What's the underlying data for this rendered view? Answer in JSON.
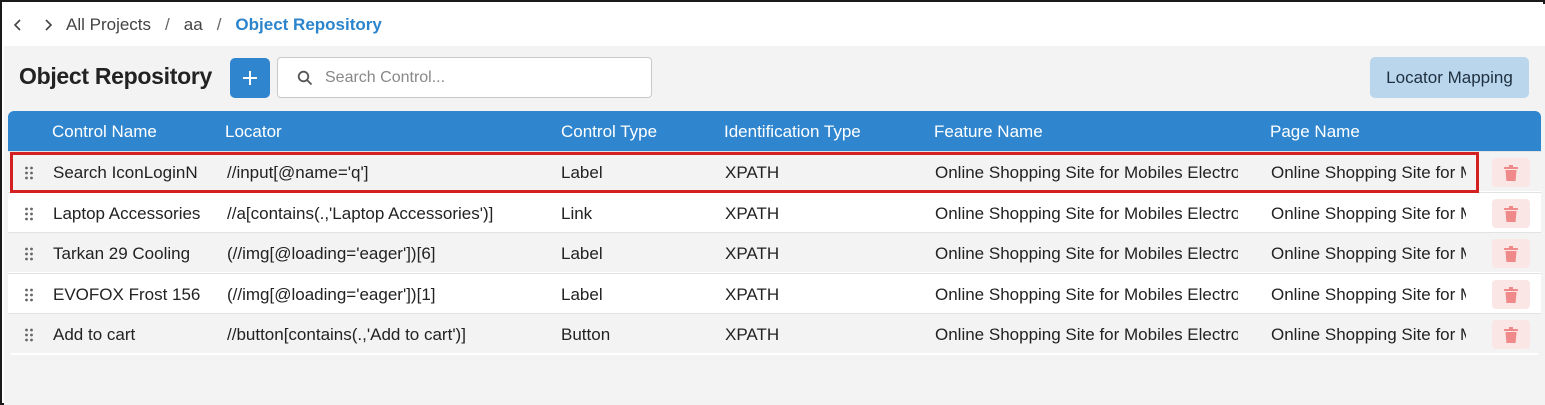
{
  "breadcrumb": {
    "items": [
      "All Projects",
      "aa"
    ],
    "separator": "/",
    "current": "Object Repository"
  },
  "header": {
    "title": "Object Repository",
    "search_placeholder": "Search Control...",
    "locator_mapping_label": "Locator Mapping"
  },
  "table": {
    "columns": [
      "Control Name",
      "Locator",
      "Control Type",
      "Identification Type",
      "Feature Name",
      "Page Name"
    ],
    "rows": [
      [
        "Search IconLoginN",
        "//input[@name='q']",
        "Label",
        "XPATH",
        "Online Shopping Site for Mobiles Electro",
        "Online Shopping Site for M"
      ],
      [
        "Laptop Accessories",
        "//a[contains(.,'Laptop Accessories')]",
        "Link",
        "XPATH",
        "Online Shopping Site for Mobiles Electro",
        "Online Shopping Site for M"
      ],
      [
        "Tarkan 29 Cooling",
        "(//img[@loading='eager'])[6]",
        "Label",
        "XPATH",
        "Online Shopping Site for Mobiles Electro",
        "Online Shopping Site for M"
      ],
      [
        "EVOFOX Frost 156",
        "(//img[@loading='eager'])[1]",
        "Label",
        "XPATH",
        "Online Shopping Site for Mobiles Electro",
        "Online Shopping Site for M"
      ],
      [
        "Add to cart",
        "//button[contains(.,'Add to cart')]",
        "Button",
        "XPATH",
        "Online Shopping Site for Mobiles Electro",
        "Online Shopping Site for M"
      ]
    ]
  },
  "icons": {
    "back": "chevron-left-icon",
    "forward": "chevron-right-icon",
    "add": "plus-icon",
    "search": "search-icon",
    "drag": "drag-handle-icon",
    "delete": "trash-icon"
  },
  "colors": {
    "accent": "#2f86cf",
    "breadcrumb_active": "#2b84cc",
    "locator_button": "#b9d6ec",
    "delete_bg": "#fbe6e6",
    "delete_icon": "#f08a8a",
    "highlight": "#d32020"
  }
}
